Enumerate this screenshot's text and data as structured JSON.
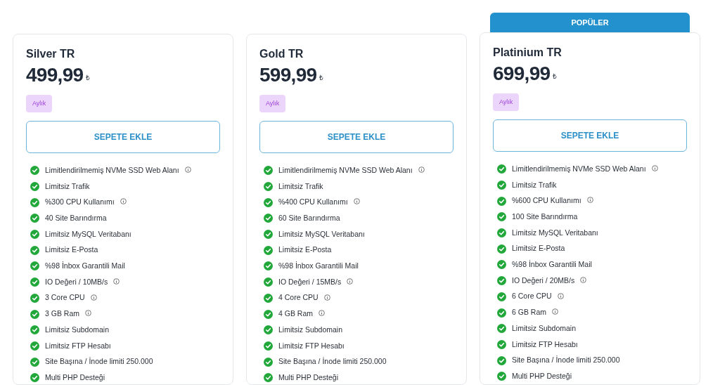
{
  "plans": [
    {
      "name": "Silver TR",
      "price": "499,99",
      "currency": "₺",
      "period": "Aylık",
      "button": "SEPETE EKLE",
      "popular": false,
      "features": [
        {
          "text": "Limitlendirilmemiş NVMe SSD Web Alanı",
          "info": true
        },
        {
          "text": "Limitsiz Trafik",
          "info": false
        },
        {
          "text": "%300 CPU Kullanımı",
          "info": true
        },
        {
          "text": "40 Site Barındırma",
          "info": false
        },
        {
          "text": "Limitsiz MySQL Veritabanı",
          "info": false
        },
        {
          "text": "Limitsiz E-Posta",
          "info": false
        },
        {
          "text": "%98 İnbox Garantili Mail",
          "info": false
        },
        {
          "text": "IO Değeri / 10MB/s",
          "info": true
        },
        {
          "text": "3 Core CPU",
          "info": true
        },
        {
          "text": "3 GB Ram",
          "info": true
        },
        {
          "text": "Limitsiz Subdomain",
          "info": false
        },
        {
          "text": "Limitsiz FTP Hesabı",
          "info": false
        },
        {
          "text": "Site Başına / İnode limiti 250.000",
          "info": false
        },
        {
          "text": "Multi PHP Desteği",
          "info": false
        }
      ]
    },
    {
      "name": "Gold TR",
      "price": "599,99",
      "currency": "₺",
      "period": "Aylık",
      "button": "SEPETE EKLE",
      "popular": false,
      "features": [
        {
          "text": "Limitlendirilmemiş NVMe SSD Web Alanı",
          "info": true
        },
        {
          "text": "Limitsiz Trafik",
          "info": false
        },
        {
          "text": "%400 CPU Kullanımı",
          "info": true
        },
        {
          "text": "60 Site Barındırma",
          "info": false
        },
        {
          "text": "Limitsiz MySQL Veritabanı",
          "info": false
        },
        {
          "text": "Limitsiz E-Posta",
          "info": false
        },
        {
          "text": "%98 İnbox Garantili Mail",
          "info": false
        },
        {
          "text": "IO Değeri / 15MB/s",
          "info": true
        },
        {
          "text": "4 Core CPU",
          "info": true
        },
        {
          "text": "4 GB Ram",
          "info": true
        },
        {
          "text": "Limitsiz Subdomain",
          "info": false
        },
        {
          "text": "Limitsiz FTP Hesabı",
          "info": false
        },
        {
          "text": "Site Başına / İnode limiti 250.000",
          "info": false
        },
        {
          "text": "Multi PHP Desteği",
          "info": false
        }
      ]
    },
    {
      "name": "Platinium TR",
      "price": "699,99",
      "currency": "₺",
      "period": "Aylık",
      "button": "SEPETE EKLE",
      "popular": true,
      "badge": "POPÜLER",
      "features": [
        {
          "text": "Limitlendirilmemiş NVMe SSD Web Alanı",
          "info": true
        },
        {
          "text": "Limitsiz Trafik",
          "info": false
        },
        {
          "text": "%600 CPU Kullanımı",
          "info": true
        },
        {
          "text": "100 Site Barındırma",
          "info": false
        },
        {
          "text": "Limitsiz MySQL Veritabanı",
          "info": false
        },
        {
          "text": "Limitsiz E-Posta",
          "info": false
        },
        {
          "text": "%98 İnbox Garantili Mail",
          "info": false
        },
        {
          "text": "IO Değeri / 20MB/s",
          "info": true
        },
        {
          "text": "6 Core CPU",
          "info": true
        },
        {
          "text": "6 GB Ram",
          "info": true
        },
        {
          "text": "Limitsiz Subdomain",
          "info": false
        },
        {
          "text": "Limitsiz FTP Hesabı",
          "info": false
        },
        {
          "text": "Site Başına / İnode limiti 250.000",
          "info": false
        },
        {
          "text": "Multi PHP Desteği",
          "info": false
        }
      ]
    }
  ]
}
